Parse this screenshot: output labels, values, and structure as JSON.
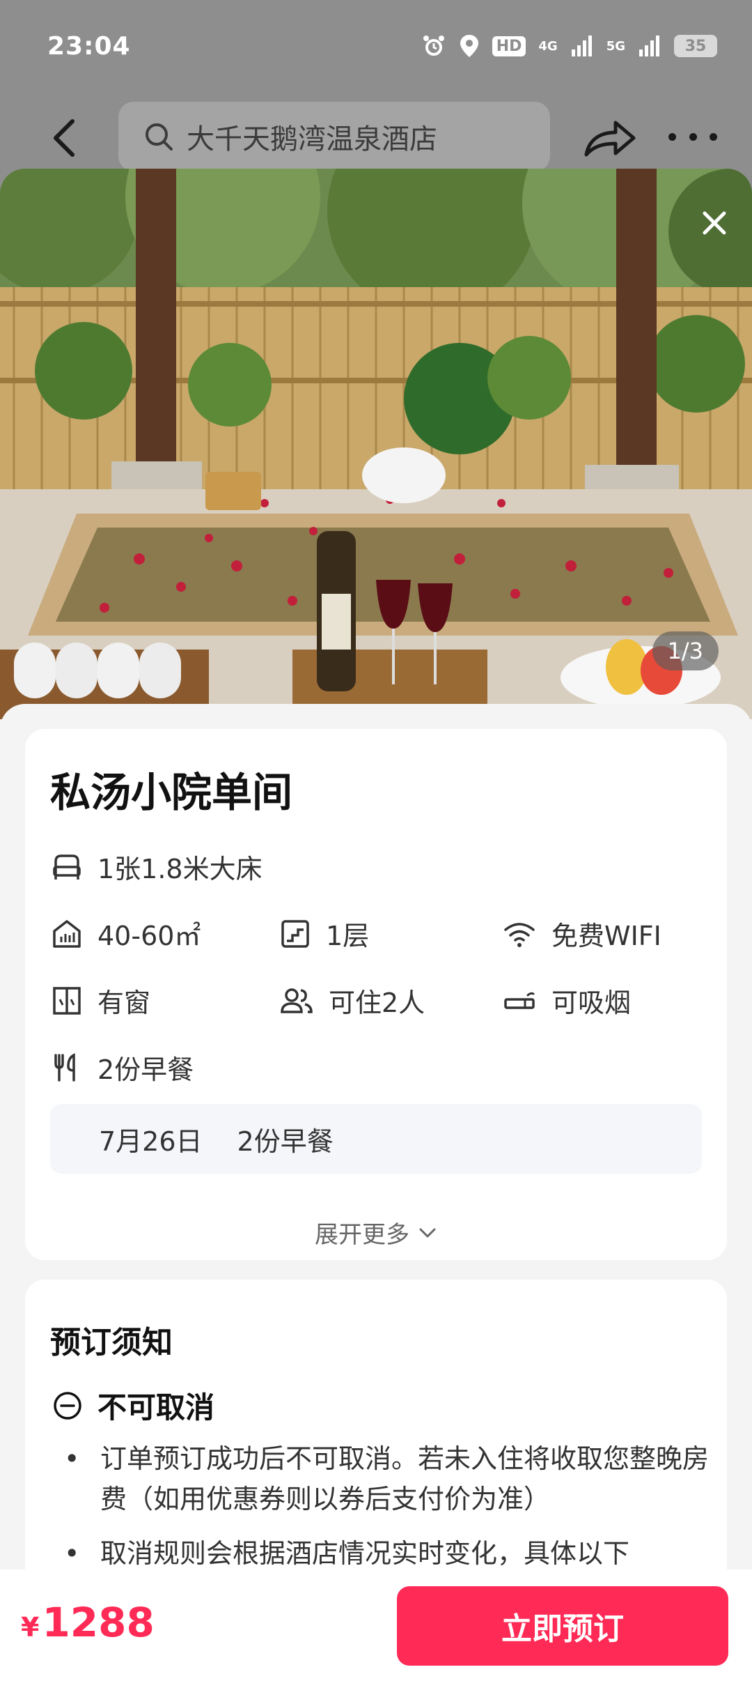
{
  "status_bar": {
    "time": "23:04",
    "hd_label": "HD",
    "net1": "4G",
    "net2": "5G",
    "battery": "35"
  },
  "header": {
    "search_text": "大千天鹅湾温泉酒店"
  },
  "gallery": {
    "counter": "1/3"
  },
  "room": {
    "title": "私汤小院单间",
    "bed": "1张1.8米大床",
    "area": "40-60㎡",
    "floor": "1层",
    "wifi": "免费WIFI",
    "window": "有窗",
    "occupancy": "可住2人",
    "smoking": "可吸烟",
    "breakfast": "2份早餐",
    "meal_date": "7月26日",
    "meal_detail": "2份早餐",
    "expand_label": "展开更多"
  },
  "notice": {
    "title": "预订须知",
    "policy": "不可取消",
    "rules": [
      "订单预订成功后不可取消。若未入住将收取您整晚房费（如用优惠券则以券后支付价为准）",
      "取消规则会根据酒店情况实时变化，具体以下"
    ]
  },
  "footer": {
    "currency": "¥",
    "price": "1288",
    "book_label": "立即预订"
  },
  "colors": {
    "accent": "#ff2a55",
    "backdrop": "#8e8e8e"
  },
  "icons": [
    "alarm-icon",
    "location-icon",
    "signal-icon",
    "battery-icon",
    "back-icon",
    "search-icon",
    "share-icon",
    "more-icon",
    "close-icon",
    "bed-icon",
    "area-icon",
    "floor-icon",
    "wifi-icon",
    "window-icon",
    "people-icon",
    "smoking-icon",
    "breakfast-icon",
    "chevron-down-icon",
    "minus-circle-icon"
  ]
}
